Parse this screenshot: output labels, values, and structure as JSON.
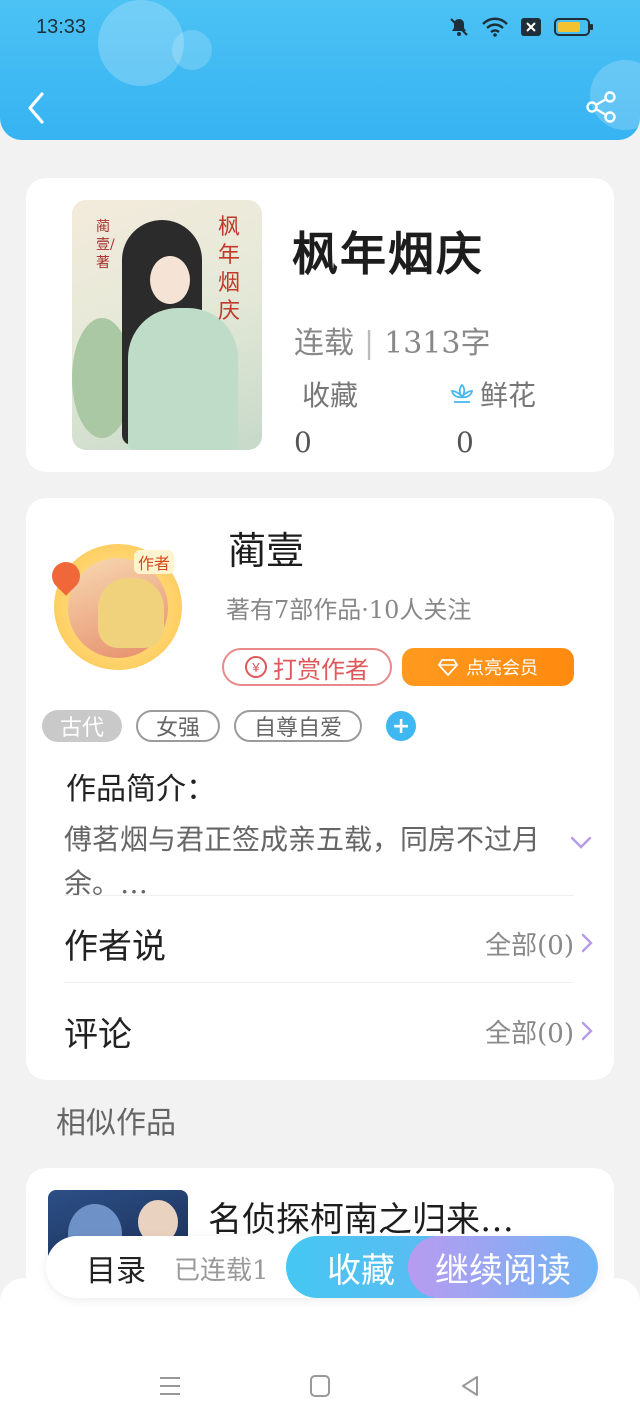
{
  "status_bar": {
    "time": "13:33",
    "icons": [
      "mute-bell-icon",
      "wifi-icon",
      "close-box-icon",
      "battery-icon"
    ]
  },
  "header": {
    "back_icon": "back-chevron-icon",
    "share_icon": "share-icon",
    "colors": {
      "gradient_start": "#4cc2f4",
      "gradient_end": "#36b3f2"
    }
  },
  "book": {
    "cover_title": "枫年烟庆",
    "cover_author": "蔺壹/著",
    "title": "枫年烟庆",
    "status": "连载",
    "word_count": "1313字",
    "collect_label": "收藏",
    "collect_count": "0",
    "flower_label": "鲜花",
    "flower_count": "0"
  },
  "author": {
    "badge": "作者",
    "name": "蔺壹",
    "stats": "著有7部作品·10人关注",
    "tip_label": "打赏作者",
    "tip_icon": "¥",
    "vip_label": "点亮会员"
  },
  "tags": [
    "古代",
    "女强",
    "自尊自爱"
  ],
  "intro": {
    "label": "作品简介：",
    "text": "傅茗烟与君正签成亲五载，同房不过月余。…"
  },
  "rows": {
    "author_says": {
      "title": "作者说",
      "right": "全部(0)"
    },
    "comments": {
      "title": "评论",
      "right": "全部(0)"
    }
  },
  "similar": {
    "section_title": "相似作品",
    "items": [
      {
        "title": "名侦探柯南之归来…"
      }
    ]
  },
  "action_bar": {
    "toc": "目录",
    "serial": "已连载1",
    "favorite": "收藏",
    "continue_reading": "继续阅读"
  },
  "nav_bar": [
    "menu-icon",
    "home-square-icon",
    "back-triangle-icon"
  ]
}
